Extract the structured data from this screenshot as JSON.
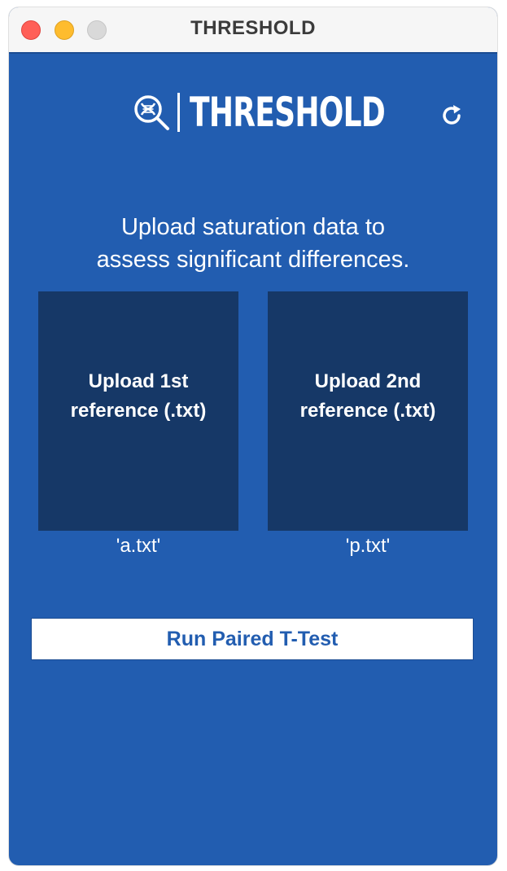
{
  "window": {
    "title": "THRESHOLD"
  },
  "header": {
    "logo_text": "THRESHOLD",
    "logo_icon": "magnifier-dna-icon",
    "refresh_icon": "refresh-icon"
  },
  "main": {
    "tagline_line1": "Upload saturation data to",
    "tagline_line2": "assess significant differences.",
    "upload_first": {
      "line1": "Upload 1st",
      "line2": "reference (.txt)",
      "file_name": "'a.txt'"
    },
    "upload_second": {
      "line1": "Upload 2nd",
      "line2": "reference (.txt)",
      "file_name": "'p.txt'"
    },
    "run_button_label": "Run Paired T-Test"
  },
  "colors": {
    "background": "#225db0",
    "upload_box": "#163867",
    "button_text": "#225db0"
  }
}
